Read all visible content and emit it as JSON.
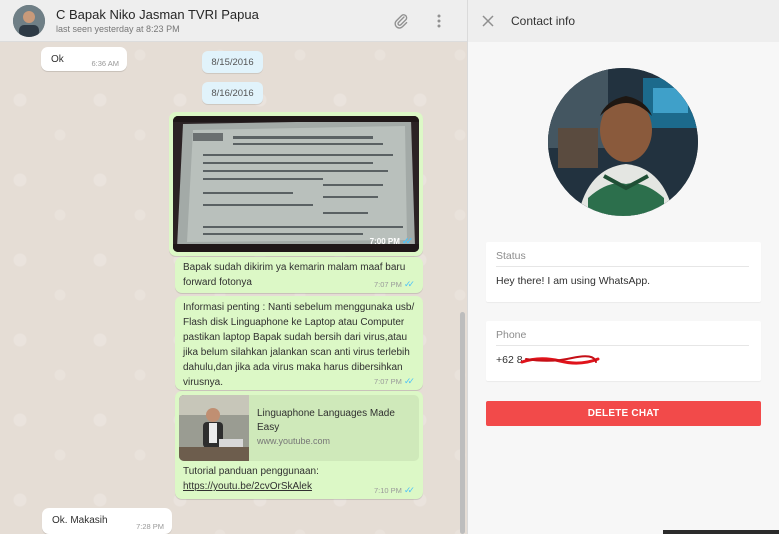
{
  "chat": {
    "title": "C Bapak Niko Jasman TVRI Papua",
    "status": "last seen yesterday at 8:23 PM",
    "icons": {
      "attach": "paperclip-icon",
      "menu": "more-vert-icon"
    },
    "messages": {
      "ok": {
        "text": "Ok",
        "time": "6:36 AM"
      },
      "date1": "8/15/2016",
      "date2": "8/16/2016",
      "photo": {
        "time": "7:00 PM",
        "ticks": "✓✓"
      },
      "msg1": {
        "text": "Bapak sudah dikirim ya kemarin malam maaf baru forward fotonya",
        "time": "7:07 PM",
        "ticks": "✓✓"
      },
      "msg2": {
        "text": "Informasi penting : Nanti sebelum menggunaka usb/ Flash disk Linguaphone ke Laptop atau Computer pastikan laptop Bapak sudah bersih dari virus,atau jika belum silahkan jalankan scan anti virus terlebih dahulu,dan jika ada virus maka harus dibersihkan virusnya.",
        "time": "7:07 PM",
        "ticks": "✓✓"
      },
      "link": {
        "title": "Linguaphone Languages Made Easy",
        "domain": "www.youtube.com",
        "caption": "Tutorial panduan penggunaan:",
        "url": "https://youtu.be/2cvOrSkAlek",
        "time": "7:10 PM",
        "ticks": "✓✓"
      },
      "last": {
        "text": "Ok. Makasih",
        "time": "7:28 PM"
      }
    }
  },
  "info": {
    "title": "Contact info",
    "close_icon": "close-icon",
    "status_label": "Status",
    "status_value": "Hey there! I am using WhatsApp.",
    "phone_label": "Phone",
    "phone_value": "+62 8",
    "delete_label": "DELETE CHAT"
  },
  "colors": {
    "outgoing_bubble": "#dcf8c6",
    "incoming_bubble": "#ffffff",
    "date_chip": "#e1f3fb",
    "read_ticks": "#4fc3f7",
    "link": "#039be5",
    "delete_button": "#f24a4a"
  }
}
